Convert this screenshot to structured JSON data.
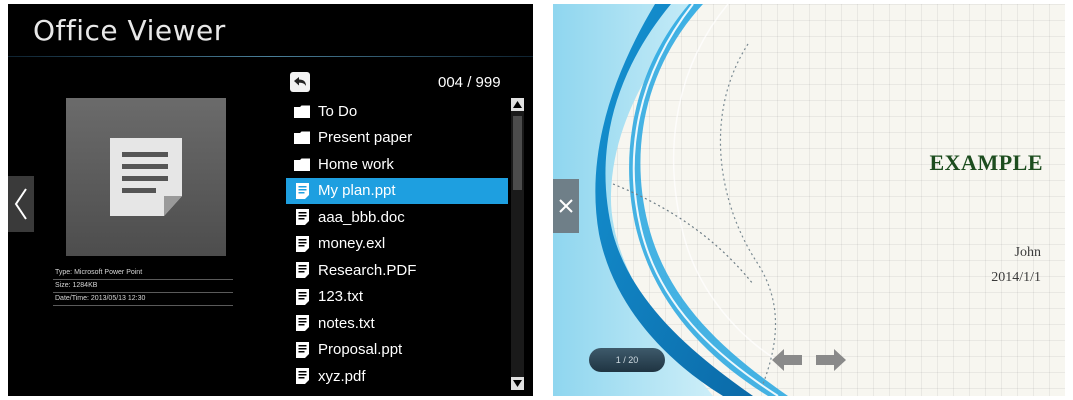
{
  "viewer": {
    "title": "Office Viewer",
    "page_counter": "004 / 999",
    "file_info": [
      "Type: Microsoft Power Point",
      "Size: 1284KB",
      "Date/Time: 2013/05/13 12:30"
    ],
    "files": [
      {
        "name": "To Do",
        "icon": "folder-icon",
        "selected": false
      },
      {
        "name": "Present paper",
        "icon": "folder-icon",
        "selected": false
      },
      {
        "name": "Home work",
        "icon": "folder-icon",
        "selected": false
      },
      {
        "name": "My plan.ppt",
        "icon": "document-icon",
        "selected": true
      },
      {
        "name": "aaa_bbb.doc",
        "icon": "document-icon",
        "selected": false
      },
      {
        "name": "money.exl",
        "icon": "document-icon",
        "selected": false
      },
      {
        "name": "Research.PDF",
        "icon": "document-icon",
        "selected": false
      },
      {
        "name": "123.txt",
        "icon": "document-icon",
        "selected": false
      },
      {
        "name": "notes.txt",
        "icon": "document-icon",
        "selected": false
      },
      {
        "name": "Proposal.ppt",
        "icon": "document-icon",
        "selected": false
      },
      {
        "name": "xyz.pdf",
        "icon": "document-icon",
        "selected": false
      }
    ],
    "colors": {
      "background": "#000000",
      "selection": "#1e9fe0"
    }
  },
  "slide": {
    "title": "Example",
    "author": "John",
    "date": "2014/1/1",
    "pager": "1 / 20",
    "colors": {
      "title": "#1d4d1f",
      "swoosh": "#1b8fcf"
    }
  }
}
